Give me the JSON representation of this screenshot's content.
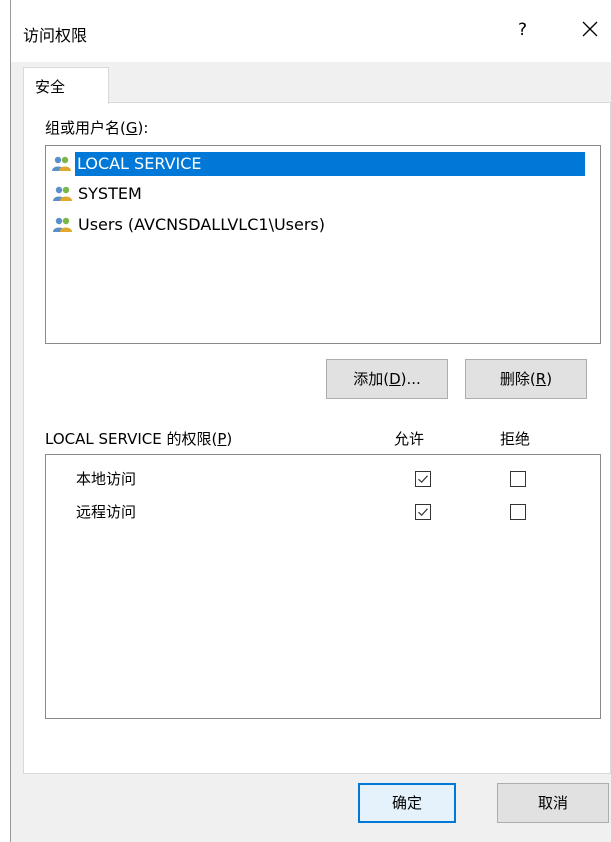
{
  "window": {
    "title": "访问权限",
    "help": "?",
    "close_icon": "close-icon"
  },
  "tabs": [
    {
      "label": "安全",
      "active": true
    }
  ],
  "groups": {
    "label_prefix": "组或用户名(",
    "label_key": "G",
    "label_suffix": "):",
    "items": [
      {
        "name": "LOCAL SERVICE",
        "icon": "users-icon",
        "selected": true
      },
      {
        "name": "SYSTEM",
        "icon": "users-icon",
        "selected": false
      },
      {
        "name": "Users (AVCNSDALLVLC1\\Users)",
        "icon": "users-icon",
        "selected": false
      }
    ]
  },
  "buttons": {
    "add_prefix": "添加(",
    "add_key": "D",
    "add_suffix": ")...",
    "remove_prefix": "删除(",
    "remove_key": "R",
    "remove_suffix": ")",
    "ok": "确定",
    "cancel": "取消"
  },
  "permissions": {
    "label_prefix": "LOCAL SERVICE 的权限(",
    "label_key": "P",
    "label_suffix": ")",
    "allow_header": "允许",
    "deny_header": "拒绝",
    "rows": [
      {
        "name": "本地访问",
        "allow": true,
        "deny": false
      },
      {
        "name": "远程访问",
        "allow": true,
        "deny": false
      }
    ]
  },
  "colors": {
    "selection": "#0078d7",
    "dialog_bg": "#f0f0f0",
    "panel_bg": "#ffffff"
  }
}
